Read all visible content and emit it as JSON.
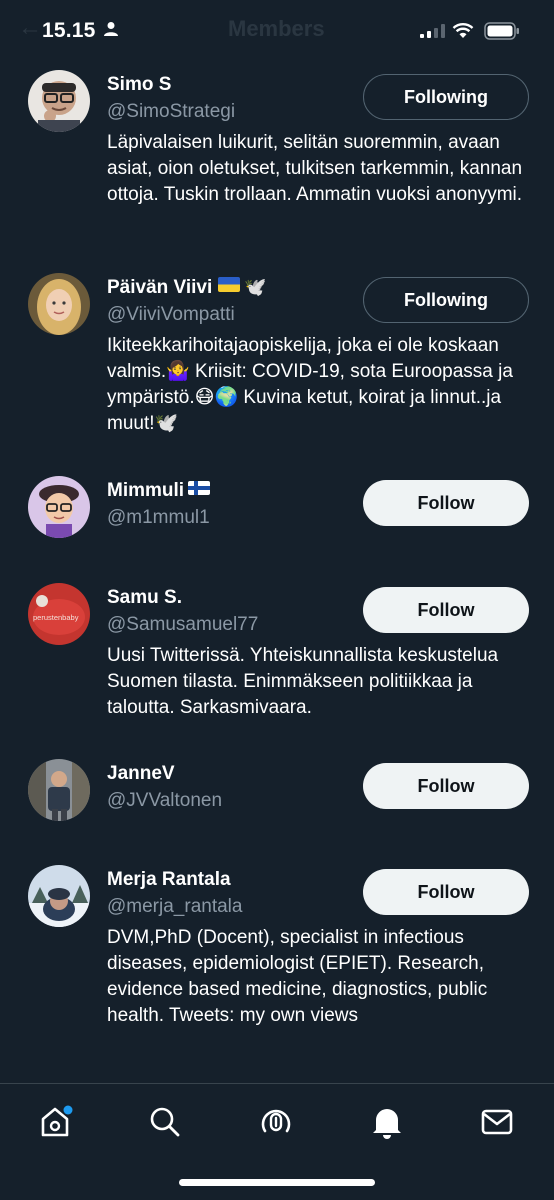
{
  "status_bar": {
    "time": "15.15"
  },
  "header": {
    "title": "Members"
  },
  "users": [
    {
      "name": "Simo S",
      "handle": "@SimoStrategi",
      "button": "Following",
      "bio": "Läpivalaisen luikurit, selitän suoremmin, avaan asiat, oion oletukset, tulkitsen tarkemmin, kannan ottoja. Tuskin trollaan. Ammatin vuoksi anonyymi."
    },
    {
      "name": "Päivän Viivi",
      "handle": "@ViiviVompatti",
      "button": "Following",
      "bio": "Ikiteekkarihoitajaopiskelija, joka ei ole koskaan valmis.🤷‍♀️ Kriisit: COVID-19, sota Euroopassa ja ympäristö.😷🌍 Kuvina ketut, koirat ja linnut..ja muut!🕊️"
    },
    {
      "name": "Mimmuli",
      "handle": "@m1mmul1",
      "button": "Follow",
      "bio": ""
    },
    {
      "name": "Samu S.",
      "handle": "@Samusamuel77",
      "button": "Follow",
      "bio": "Uusi Twitterissä. Yhteiskunnallista keskustelua Suomen tilasta. Enimmäkseen politiikkaa ja taloutta. Sarkasmivaara.",
      "avatar_text": "perustenbaby"
    },
    {
      "name": "JanneV",
      "handle": "@JVValtonen",
      "button": "Follow",
      "bio": ""
    },
    {
      "name": "Merja Rantala",
      "handle": "@merja_rantala",
      "button": "Follow",
      "bio": "DVM,PhD (Docent), specialist in infectious diseases, epidemiologist (EPIET). Research, evidence based medicine, diagnostics, public health. Tweets: my own views"
    }
  ],
  "tabs": [
    {
      "icon": "home-icon",
      "has_badge": true
    },
    {
      "icon": "search-icon"
    },
    {
      "icon": "spaces-icon"
    },
    {
      "icon": "notifications-icon"
    },
    {
      "icon": "messages-icon"
    }
  ],
  "colors": {
    "background": "#15202b",
    "secondary_text": "#8b98a5",
    "accent": "#1d9bf0",
    "follow_button_bg": "#eff3f4"
  }
}
